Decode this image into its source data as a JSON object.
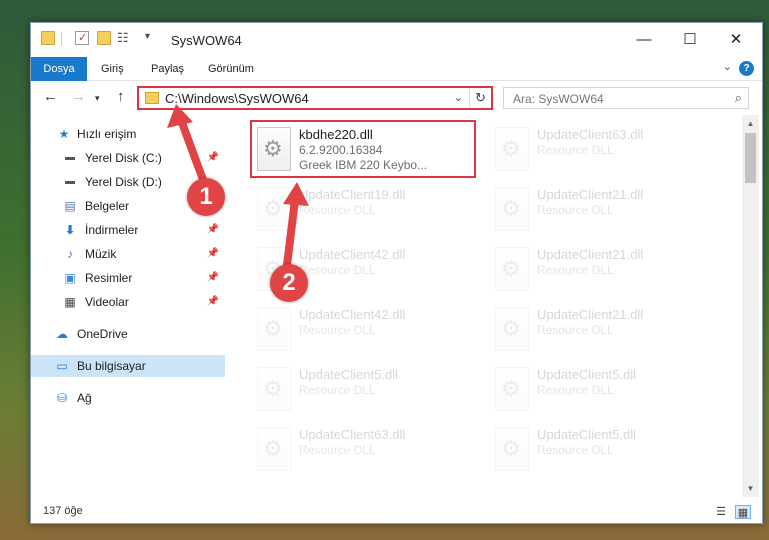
{
  "window": {
    "title": "SysWOW64",
    "controls": {
      "minimize": "—",
      "maximize": "☐",
      "close": "✕"
    }
  },
  "ribbon": {
    "tabs": [
      "Dosya",
      "Giriş",
      "Paylaş",
      "Görünüm"
    ],
    "help": "?"
  },
  "navigation": {
    "address": "C:\\Windows\\SysWOW64",
    "search_placeholder": "Ara: SysWOW64"
  },
  "sidebar": {
    "items": [
      {
        "label": "Hızlı erişim",
        "icon": "star-icon",
        "pinned": false
      },
      {
        "label": "Yerel Disk (C:)",
        "icon": "drive-icon",
        "pinned": true
      },
      {
        "label": "Yerel Disk (D:)",
        "icon": "drive-icon",
        "pinned": false
      },
      {
        "label": "Belgeler",
        "icon": "document-icon",
        "pinned": true
      },
      {
        "label": "İndirmeler",
        "icon": "download-icon",
        "pinned": true
      },
      {
        "label": "Müzik",
        "icon": "music-icon",
        "pinned": true
      },
      {
        "label": "Resimler",
        "icon": "picture-icon",
        "pinned": true
      },
      {
        "label": "Videolar",
        "icon": "video-icon",
        "pinned": true
      },
      {
        "label": "OneDrive",
        "icon": "cloud-icon",
        "pinned": false
      },
      {
        "label": "Bu bilgisayar",
        "icon": "computer-icon",
        "pinned": false,
        "selected": true
      },
      {
        "label": "Ağ",
        "icon": "network-icon",
        "pinned": false
      }
    ]
  },
  "files": [
    {
      "name": "kbdhe220.dll",
      "line2": "6.2.9200.16384",
      "line3": "Greek IBM 220 Keybo...",
      "highlighted": true
    },
    {
      "name": "UpdateClient63.dll",
      "line2": "Resource DLL",
      "line3": ""
    },
    {
      "name": "UpdateClient19.dll",
      "line2": "Resource DLL",
      "line3": ""
    },
    {
      "name": "UpdateClient21.dll",
      "line2": "Resource DLL",
      "line3": ""
    },
    {
      "name": "UpdateClient42.dll",
      "line2": "Resource DLL",
      "line3": ""
    },
    {
      "name": "UpdateClient21.dll",
      "line2": "Resource DLL",
      "line3": ""
    },
    {
      "name": "UpdateClient42.dll",
      "line2": "Resource DLL",
      "line3": ""
    },
    {
      "name": "UpdateClient21.dll",
      "line2": "Resource DLL",
      "line3": ""
    },
    {
      "name": "UpdateClient5.dll",
      "line2": "Resource DLL",
      "line3": ""
    },
    {
      "name": "UpdateClient5.dll",
      "line2": "Resource DLL",
      "line3": ""
    },
    {
      "name": "UpdateClient63.dll",
      "line2": "Resource DLL",
      "line3": ""
    },
    {
      "name": "UpdateClient5.dll",
      "line2": "Resource DLL",
      "line3": ""
    }
  ],
  "status": {
    "item_count": "137 öğe"
  },
  "annotations": {
    "step1": "1",
    "step2": "2",
    "color": "#e04444"
  }
}
